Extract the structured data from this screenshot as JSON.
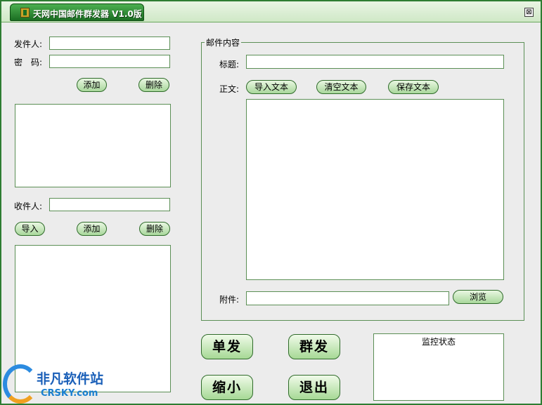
{
  "window": {
    "title": "天网中国邮件群发器 V1.0版",
    "close_glyph": "⊠"
  },
  "sender": {
    "sender_label": "发件人:",
    "password_label": "密　码:",
    "sender_value": "",
    "password_value": "",
    "add_label": "添加",
    "delete_label": "删除"
  },
  "recipient": {
    "recipient_label": "收件人:",
    "recipient_value": "",
    "import_label": "导入",
    "add_label": "添加",
    "delete_label": "删除"
  },
  "mail": {
    "group_label": "邮件内容",
    "subject_label": "标题:",
    "subject_value": "",
    "body_label": "正文:",
    "import_text_label": "导入文本",
    "clear_text_label": "清空文本",
    "save_text_label": "保存文本",
    "attachment_label": "附件:",
    "attachment_value": "",
    "browse_label": "浏览"
  },
  "actions": {
    "single_send_label": "单发",
    "group_send_label": "群发",
    "minimize_label": "缩小",
    "exit_label": "退出"
  },
  "monitor": {
    "title": "监控状态"
  },
  "watermark": {
    "cn": "非凡软件站",
    "en": "CRSKY.com"
  }
}
